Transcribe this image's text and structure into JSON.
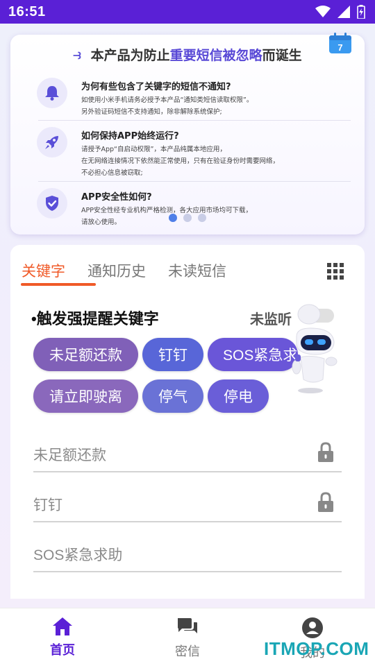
{
  "status_bar": {
    "time": "16:51",
    "icons": [
      "wifi-icon",
      "signal-icon",
      "battery-charging-icon"
    ]
  },
  "info_card": {
    "banner": {
      "prefix": "本产品为防止",
      "highlight": "重要短信被忽略",
      "suffix": "而诞生"
    },
    "calendar_day": "7",
    "faqs": [
      {
        "icon": "bell-icon",
        "question": "为何有些包含了关键字的短信不通知?",
        "answer": "如使用小米手机请务必授予本产品“通知类短信读取权限”。\n另外验证码短信不支持通知，除非解除系统保护;"
      },
      {
        "icon": "rocket-icon",
        "question": "如何保持APP始终运行?",
        "answer": "请授予App“自启动权限”，本产品纯属本地应用，\n在无网络连接情况下依然能正常使用，只有在验证身份时需要网络，\n不必担心信息被窃取;"
      },
      {
        "icon": "shield-check-icon",
        "question": "APP安全性如何?",
        "answer": "APP安全性经专业机构严格检测，各大应用市场均可下载，\n请放心使用。"
      }
    ],
    "carousel": {
      "count": 3,
      "active_index": 0
    }
  },
  "tabs": [
    {
      "label": "关键字",
      "active": true
    },
    {
      "label": "通知历史",
      "active": false
    },
    {
      "label": "未读短信",
      "active": false
    }
  ],
  "keywords_section": {
    "title": "•触发强提醒关键字",
    "monitor_status": "未监听",
    "chips": [
      {
        "label": "未足额还款",
        "color": "#8060b8"
      },
      {
        "label": "钉钉",
        "color": "#5866d8"
      },
      {
        "label": "SOS紧急求",
        "color": "#6a56d8"
      },
      {
        "label": "请立即驶离",
        "color": "#8a68bc"
      },
      {
        "label": "停气",
        "color": "#6a72d6"
      },
      {
        "label": "停电",
        "color": "#6a5ed8"
      }
    ],
    "fields": [
      {
        "placeholder": "未足额还款",
        "locked": true
      },
      {
        "placeholder": "钉钉",
        "locked": true
      },
      {
        "placeholder": "SOS紧急求助",
        "locked": false
      }
    ]
  },
  "bottom_nav": [
    {
      "label": "首页",
      "icon": "home-icon",
      "active": true
    },
    {
      "label": "密信",
      "icon": "chat-icon",
      "active": false
    },
    {
      "label": "我的",
      "icon": "user-icon",
      "active": false
    }
  ],
  "watermark": "ITMOP.COM",
  "colors": {
    "status_bar": "#5a20d6",
    "accent": "#f05a28",
    "nav_active": "#5a20d6",
    "carousel_active": "#4f7fe8"
  }
}
